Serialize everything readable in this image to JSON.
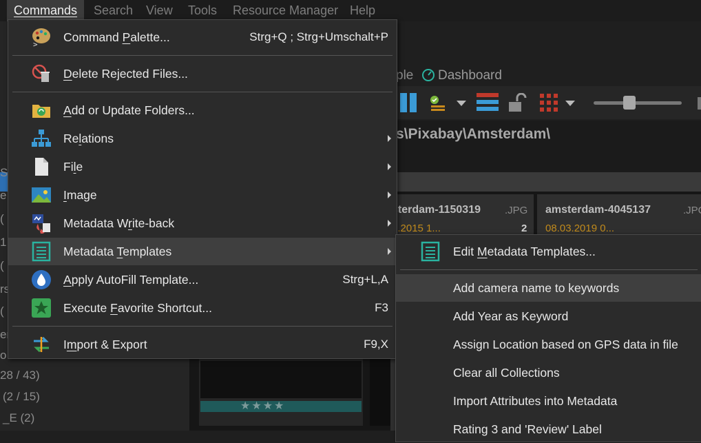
{
  "menubar": {
    "items": [
      "Commands",
      "Search",
      "View",
      "Tools",
      "Resource Manager",
      "Help"
    ]
  },
  "background": {
    "tab_fragment": "ple",
    "dashboard_tab": "Dashboard",
    "path_text": "s\\Pixabay\\Amsterdam\\",
    "left_fragments": [
      "S",
      "e",
      "(",
      "1",
      "(",
      "rs",
      "(",
      "er",
      "o",
      "28 / 43)",
      "(2 / 15)",
      "_E (2)"
    ],
    "thumbnails": [
      {
        "name": "sterdam-1150319",
        "ext": ".JPG",
        "date": "3.2015 1...",
        "count": "2"
      },
      {
        "name": "amsterdam-4045137",
        "ext": ".JPG",
        "date": "08.03.2019 0..."
      }
    ],
    "rating_stars": "★★★★"
  },
  "commands_menu": {
    "items": [
      {
        "label": "Command Palette...",
        "accel_index": 8,
        "shortcut": "Strg+Q ; Strg+Umschalt+P",
        "icon": "palette-icon",
        "submenu": false
      },
      {
        "sep": true
      },
      {
        "label": "Delete Rejected Files...",
        "accel_index": 0,
        "shortcut": "",
        "icon": "delete-rejected-icon",
        "submenu": false
      },
      {
        "sep": true
      },
      {
        "label": "Add or Update Folders...",
        "accel_index": 0,
        "shortcut": "",
        "icon": "folder-sync-icon",
        "submenu": false
      },
      {
        "label": "Relations",
        "accel_index": 2,
        "shortcut": "",
        "icon": "relations-icon",
        "submenu": true
      },
      {
        "label": "File",
        "accel_index": 2,
        "shortcut": "",
        "icon": "file-icon",
        "submenu": true
      },
      {
        "label": "Image",
        "accel_index": 0,
        "shortcut": "",
        "icon": "image-icon",
        "submenu": true
      },
      {
        "label": "Metadata Write-back",
        "accel_index": 10,
        "shortcut": "",
        "icon": "metadata-writeback-icon",
        "submenu": true
      },
      {
        "label": "Metadata Templates",
        "accel_index": 9,
        "shortcut": "",
        "icon": "template-icon",
        "submenu": true,
        "hover": true
      },
      {
        "label": "Apply AutoFill Template...",
        "accel_index": 0,
        "shortcut": "Strg+L,A",
        "icon": "autofill-icon",
        "submenu": false
      },
      {
        "label": "Execute Favorite Shortcut...",
        "accel_index": 8,
        "shortcut": "F3",
        "icon": "favorite-star-icon",
        "submenu": false
      },
      {
        "sep": true
      },
      {
        "label": "Import & Export",
        "accel_index": 1,
        "shortcut": "F9,X",
        "icon": "import-export-icon",
        "submenu": false
      }
    ]
  },
  "templates_submenu": {
    "items": [
      {
        "label": "Edit Metadata Templates...",
        "accel_index": 5,
        "icon": "template-icon"
      },
      {
        "sep": true
      },
      {
        "label": "Add camera name to keywords",
        "hover": true
      },
      {
        "label": "Add Year as Keyword"
      },
      {
        "label": "Assign Location based on GPS data in file"
      },
      {
        "label": "Clear all Collections"
      },
      {
        "label": "Import Attributes into Metadata"
      },
      {
        "label": "Rating 3 and 'Review' Label"
      }
    ]
  },
  "colors": {
    "menu_bg": "#2b2b2b",
    "hover_bg": "#3f3f3f",
    "date_accent": "#c08a1c",
    "icon_teal": "#2ab3a0"
  }
}
